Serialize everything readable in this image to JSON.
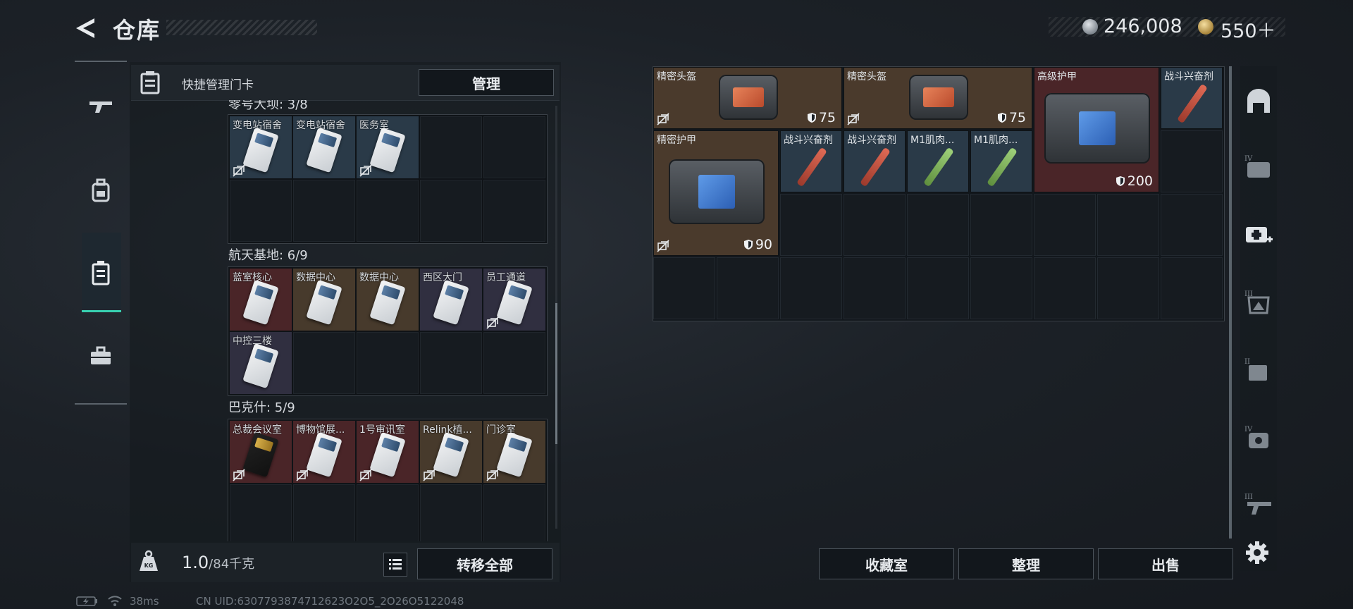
{
  "header": {
    "title": "仓库",
    "currency1": "246,008",
    "currency2": "550＋"
  },
  "left_nav": {
    "items": [
      "weapon-icon",
      "backpack-icon",
      "keycard-icon",
      "toolbox-icon"
    ],
    "active": "keycard-icon"
  },
  "keycard_panel": {
    "label": "快捷管理门卡",
    "manage_button": "管理",
    "section0_title": "零号大坝: 3/8",
    "section0_cards": [
      {
        "label": "变电站宿舍",
        "color": "blue",
        "locked": true
      },
      {
        "label": "变电站宿舍",
        "color": "blue",
        "locked": false
      },
      {
        "label": "医务室",
        "color": "blue",
        "locked": true
      }
    ],
    "section1_title": "航天基地: 6/9",
    "section1_cards": [
      {
        "label": "蓝室核心",
        "color": "red",
        "locked": false
      },
      {
        "label": "数据中心",
        "color": "brown",
        "locked": false
      },
      {
        "label": "数据中心",
        "color": "brown",
        "locked": false
      },
      {
        "label": "西区大门",
        "color": "purple",
        "locked": false
      },
      {
        "label": "员工通道",
        "color": "purple",
        "locked": true
      },
      {
        "label": "中控三楼",
        "color": "purple",
        "locked": false
      }
    ],
    "section2_title": "巴克什: 5/9",
    "section2_cards": [
      {
        "label": "总裁会议室",
        "color": "red",
        "locked": true
      },
      {
        "label": "博物馆展...",
        "color": "red",
        "locked": true
      },
      {
        "label": "1号审讯室",
        "color": "red",
        "locked": true
      },
      {
        "label": "Relink植...",
        "color": "brown",
        "locked": true
      },
      {
        "label": "门诊室",
        "color": "brown",
        "locked": true
      }
    ],
    "weight_value": "1.0",
    "weight_max": "/84千克",
    "transfer_all": "转移全部"
  },
  "storage": {
    "items": [
      {
        "name": "精密头盔",
        "armor": "75"
      },
      {
        "name": "精密头盔",
        "armor": "75"
      },
      {
        "name": "高级护甲",
        "armor": "200"
      },
      {
        "name": "战斗兴奋剂"
      },
      {
        "name": "精密护甲",
        "armor": "90"
      },
      {
        "name": "战斗兴奋剂"
      },
      {
        "name": "战斗兴奋剂"
      },
      {
        "name": "M1肌肉..."
      },
      {
        "name": "M1肌肉..."
      }
    ],
    "buttons": {
      "collection": "收藏室",
      "sort": "整理",
      "sell": "出售"
    }
  },
  "right_nav": {
    "items": [
      "safe-icon",
      "tier4-bag-icon",
      "medkit-add-icon",
      "tier3-armor-icon",
      "tier2-vest-icon",
      "tier4-helmet-icon",
      "tier3-weapon-icon"
    ]
  },
  "status_bar": {
    "ping": "38ms",
    "uid": "CN UID:6307793874712623O2O5_2O26O5122048"
  }
}
